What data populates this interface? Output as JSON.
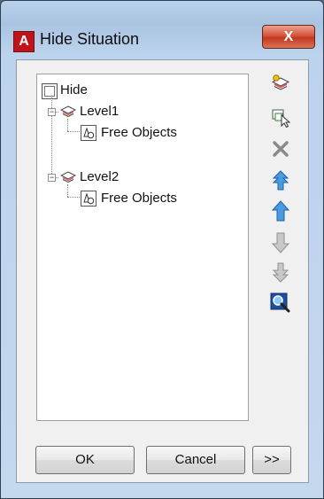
{
  "window": {
    "title": "Hide Situation",
    "close_label": "X",
    "logo_letter": "A"
  },
  "tree": {
    "root": {
      "label": "Hide",
      "icon": "hide-root-icon"
    },
    "levels": [
      {
        "label": "Level1",
        "child": "Free Objects"
      },
      {
        "label": "Level2",
        "child": "Free Objects"
      }
    ]
  },
  "toolbar": {
    "icons": [
      "new-level-icon",
      "select-objects-icon",
      "delete-icon",
      "move-top-icon",
      "move-up-icon",
      "move-down-icon",
      "move-bottom-icon",
      "zoom-icon"
    ]
  },
  "footer": {
    "ok_label": "OK",
    "cancel_label": "Cancel",
    "more_label": ">>"
  },
  "colors": {
    "accent": "#2f7fd6",
    "close": "#c2381f",
    "logo": "#c0141a"
  }
}
